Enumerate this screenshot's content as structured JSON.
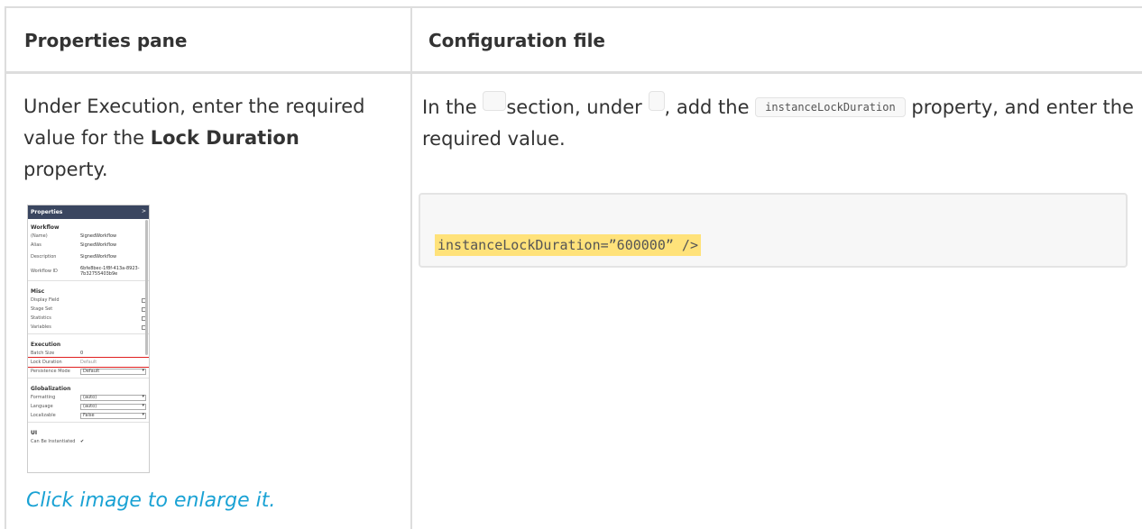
{
  "table": {
    "headers": [
      "Properties pane",
      "Configuration file"
    ]
  },
  "left_cell": {
    "intro": "Under Execution, enter the required value for the ",
    "bold": "Lock Duration",
    "outro": " property.",
    "caption": "Click image to enlarge it."
  },
  "right_cell": {
    "part1": "In the ",
    "part2": "section, under ",
    "part3": ", add the ",
    "inline_code": "instanceLockDuration",
    "part4": " property, and enter the required value.",
    "code_line": "instanceLockDuration=”600000” />"
  },
  "thumbnail": {
    "title": "Properties",
    "close": ">",
    "groups": [
      {
        "name": "Workflow",
        "rows": [
          {
            "key": "(Name)",
            "value": "SignedWorkflow"
          },
          {
            "key": "Alias",
            "value": "SignedWorkflow"
          },
          {
            "key": "Description",
            "value": "SignedWorkflow"
          },
          {
            "key": "Workflow ID",
            "value": "6bfe8bec-1f8f-413a-8923-7b32755403b9e"
          }
        ]
      },
      {
        "name": "Misc",
        "rows": [
          {
            "key": "Display Field",
            "value": ""
          },
          {
            "key": "Stage Set",
            "value": ""
          },
          {
            "key": "Statistics",
            "value": ""
          },
          {
            "key": "Variables",
            "value": ""
          }
        ]
      },
      {
        "name": "Execution",
        "rows": [
          {
            "key": "Batch Size",
            "value": "0"
          },
          {
            "key": "Lock Duration",
            "value": "Default"
          },
          {
            "key": "Persistence Mode",
            "value": "Default"
          }
        ]
      },
      {
        "name": "Globalization",
        "rows": [
          {
            "key": "Formatting",
            "value": "(auto)"
          },
          {
            "key": "Language",
            "value": "(auto)"
          },
          {
            "key": "Localizable",
            "value": "False"
          }
        ]
      },
      {
        "name": "UI",
        "rows": [
          {
            "key": "Can Be Instantiated",
            "value": "✔"
          }
        ]
      }
    ]
  }
}
